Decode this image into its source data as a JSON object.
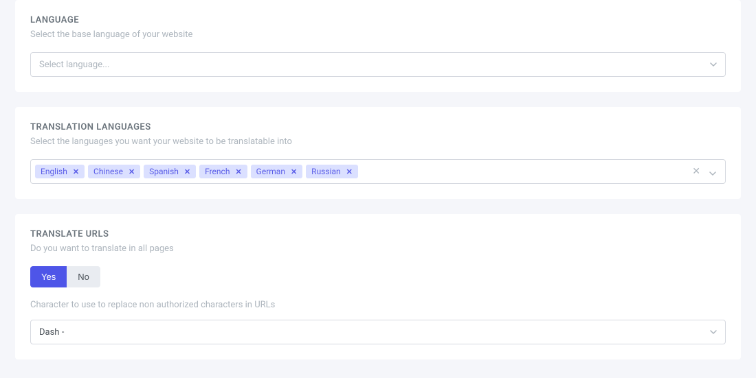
{
  "language": {
    "title": "LANGUAGE",
    "subtitle": "Select the base language of your website",
    "placeholder": "Select language..."
  },
  "translation": {
    "title": "TRANSLATION LANGUAGES",
    "subtitle": "Select the languages you want your website to be translatable into",
    "tags": [
      "English",
      "Chinese",
      "Spanish",
      "French",
      "German",
      "Russian"
    ]
  },
  "urls": {
    "title": "TRANSLATE URLS",
    "subtitle": "Do you want to translate in all pages",
    "yes": "Yes",
    "no": "No",
    "hint": "Character to use to replace non authorized characters in URLs",
    "selected": "Dash -"
  }
}
